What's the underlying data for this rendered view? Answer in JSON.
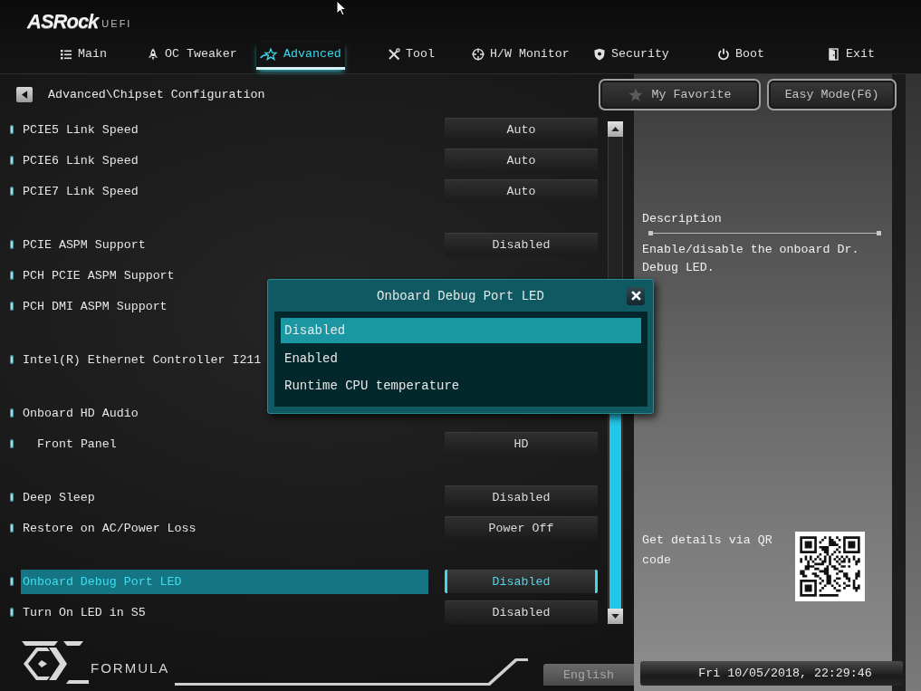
{
  "logo": {
    "brand": "ASRock",
    "suffix": "UEFI"
  },
  "tabs": [
    {
      "label": "Main",
      "selected": false
    },
    {
      "label": "OC Tweaker",
      "selected": false
    },
    {
      "label": "Advanced",
      "selected": true
    },
    {
      "label": "Tool",
      "selected": false
    },
    {
      "label": "H/W Monitor",
      "selected": false
    },
    {
      "label": "Security",
      "selected": false
    },
    {
      "label": "Boot",
      "selected": false
    },
    {
      "label": "Exit",
      "selected": false
    }
  ],
  "breadcrumb": {
    "path": "Advanced\\Chipset Configuration"
  },
  "header_buttons": [
    {
      "kind": "favorite",
      "label": "My Favorite"
    },
    {
      "kind": "mode",
      "label": "Easy Mode(F6)"
    }
  ],
  "settings": {
    "sections": [
      {
        "rows": [
          {
            "label": "PCIE5 Link Speed",
            "value": "Auto",
            "selected": false
          },
          {
            "label": "PCIE6 Link Speed",
            "value": "Auto",
            "selected": false
          },
          {
            "label": "PCIE7 Link Speed",
            "value": "Auto",
            "selected": false
          }
        ]
      },
      {
        "rows": [
          {
            "label": "PCIE ASPM Support",
            "value": "Disabled",
            "selected": false
          },
          {
            "label": "PCH PCIE ASPM Support",
            "selected": false
          },
          {
            "label": "PCH DMI ASPM Support",
            "selected": false
          }
        ]
      },
      {
        "rows": [
          {
            "label": "Intel(R) Ethernet Controller I211",
            "selected": false
          }
        ]
      },
      {
        "rows": [
          {
            "label": "Onboard HD Audio",
            "selected": false,
            "children": [
              {
                "label": "Front Panel",
                "value": "HD",
                "selected": false
              }
            ]
          }
        ]
      },
      {
        "rows": [
          {
            "label": "Deep Sleep",
            "value": "Disabled",
            "selected": false
          },
          {
            "label": "Restore on AC/Power Loss",
            "value": "Power Off",
            "selected": false
          }
        ]
      },
      {
        "rows": [
          {
            "label": "Onboard Debug Port LED",
            "value": "Disabled",
            "selected": true
          },
          {
            "label": "Turn On LED in S5",
            "value": "Disabled",
            "selected": false
          }
        ]
      }
    ]
  },
  "popup": {
    "title": "Onboard Debug Port LED",
    "options": [
      {
        "label": "Disabled",
        "selected": true
      },
      {
        "label": "Enabled",
        "selected": false
      },
      {
        "label": "Runtime CPU temperature",
        "selected": false
      }
    ]
  },
  "description": {
    "heading": "Description",
    "text": "Enable/disable the onboard Dr. Debug LED."
  },
  "qr": {
    "caption": "Get details via QR code"
  },
  "footer": {
    "logo_text": "FORMULA",
    "language": "English",
    "datetime": "Fri 10/05/2018, 22:29:46"
  }
}
